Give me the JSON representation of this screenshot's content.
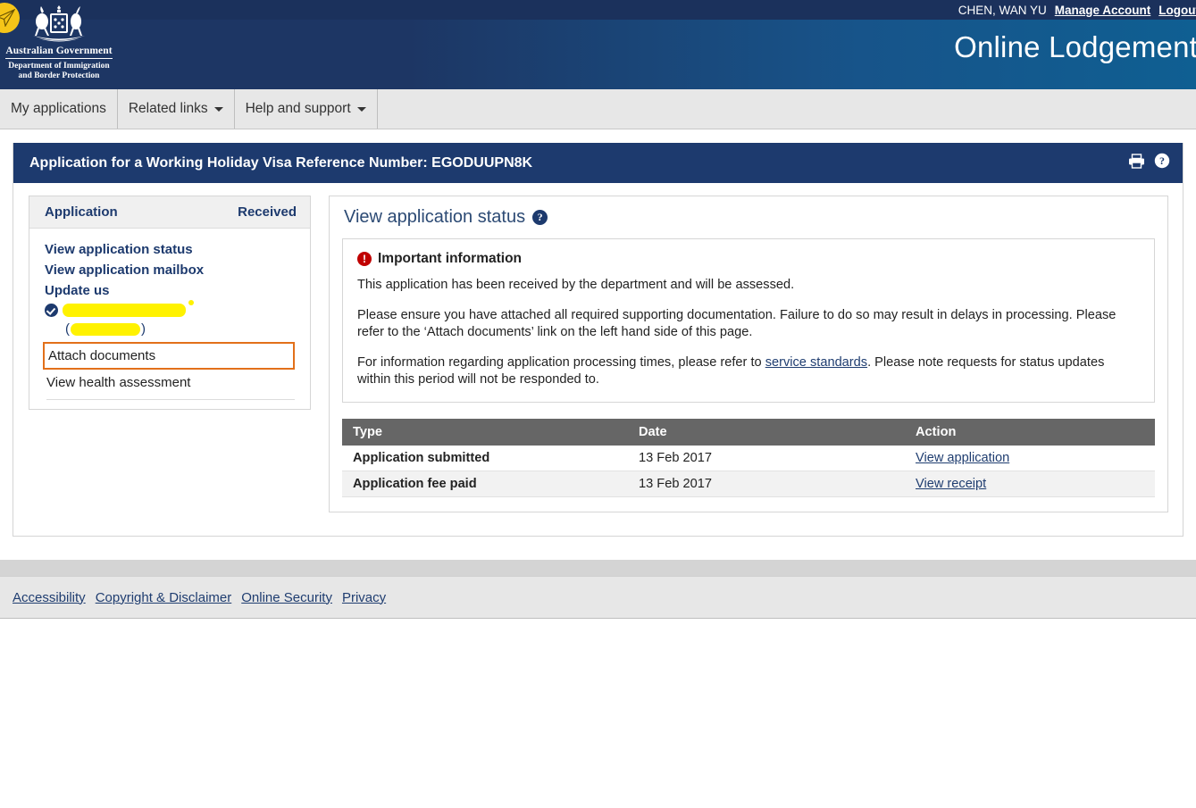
{
  "banner": {
    "user_name": "CHEN, WAN YU",
    "manage_account": "Manage Account",
    "logout": "Logout",
    "crest_gov": "Australian Government",
    "crest_dept_line1": "Department of Immigration",
    "crest_dept_line2": "and Border Protection",
    "title": "Online Lodgement",
    "logo_icon": "paper-plane-icon",
    "colors": {
      "navy": "#1d3664",
      "blue": "#0f5f92",
      "utility_bar": "#1b315c",
      "logo_yellow": "#f5c518"
    }
  },
  "nav": {
    "items": [
      {
        "label": "My applications",
        "has_caret": false
      },
      {
        "label": "Related links",
        "has_caret": true
      },
      {
        "label": "Help and support",
        "has_caret": true
      }
    ]
  },
  "card": {
    "title": "Application for a Working Holiday Visa Reference Number: EGODUUPN8K",
    "print_icon": "printer-icon",
    "help_icon": "help-icon"
  },
  "sidebar": {
    "head_left": "Application",
    "head_right": "Received",
    "links": [
      "View application status",
      "View application mailbox",
      "Update us"
    ],
    "redacted_row1": "",
    "redacted_row2_open": "(",
    "redacted_row2_close": ")",
    "check_icon": "check-circle-icon",
    "plain_links": [
      {
        "label": "Attach documents",
        "annotated": true
      },
      {
        "label": "View health assessment",
        "annotated": false
      }
    ],
    "annotation_color": "#e2701a",
    "highlight_color": "#fff200"
  },
  "main": {
    "title": "View application status",
    "help_icon": "help-icon",
    "info": {
      "heading": "Important information",
      "alert_icon": "alert-circle-icon",
      "paragraph1": "This application has been received by the department and will be assessed.",
      "paragraph2": "Please ensure you have attached all required supporting documentation. Failure to do so may result in delays in processing. Please refer to the ‘Attach documents’ link on the left hand side of this page.",
      "paragraph3_before": "For information regarding application processing times, please refer to ",
      "paragraph3_link": "service standards",
      "paragraph3_after": ". Please note requests for status updates within this period will not be responded to."
    },
    "table": {
      "headers": [
        "Type",
        "Date",
        "Action"
      ],
      "rows": [
        {
          "type": "Application submitted",
          "date": "13 Feb 2017",
          "action": "View application"
        },
        {
          "type": "Application fee paid",
          "date": "13 Feb 2017",
          "action": "View receipt"
        }
      ]
    }
  },
  "footer": {
    "links": [
      "Accessibility",
      "Copyright & Disclaimer",
      "Online Security",
      "Privacy"
    ]
  }
}
